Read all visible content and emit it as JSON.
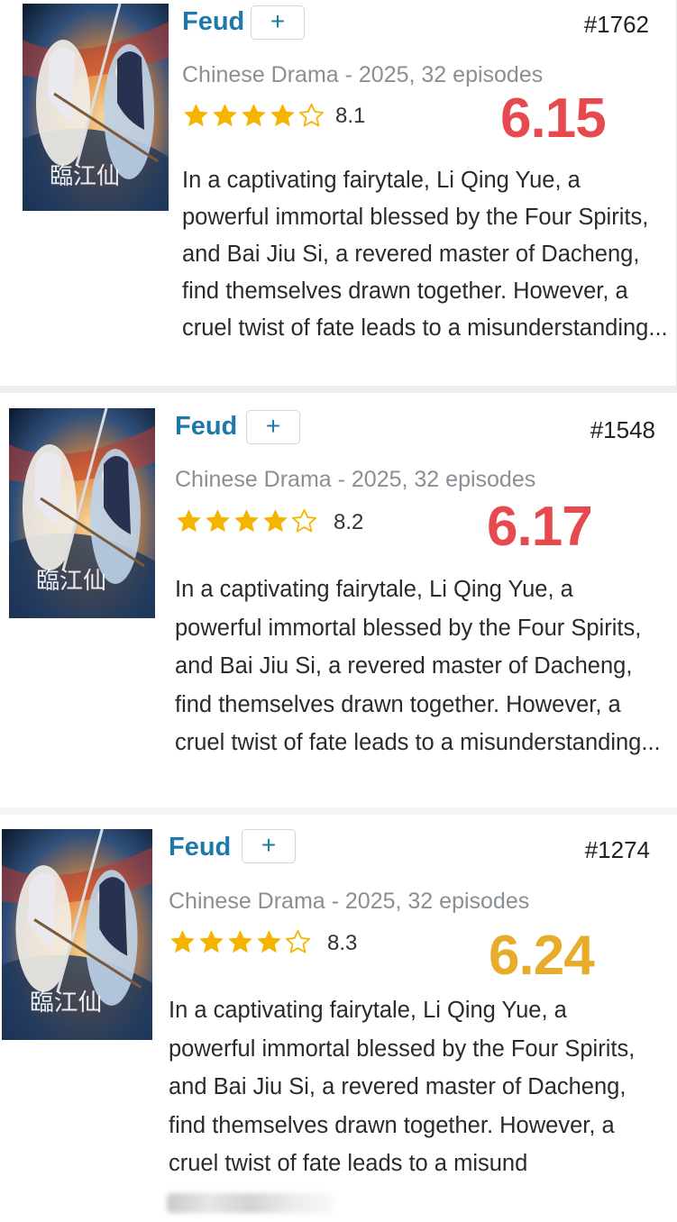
{
  "colors": {
    "title": "#1c79aa",
    "star": "#f5b400",
    "score_red": "#e64a4f",
    "score_gold": "#e8ac2c"
  },
  "entries": [
    {
      "title": "Feud",
      "add_label": "+",
      "rank": "#1762",
      "meta": "Chinese Drama - 2025, 32 episodes",
      "stars": 4,
      "rating": "8.1",
      "score": "6.15",
      "score_color": "red",
      "description": "In a captivating fairytale, Li Qing Yue, a powerful immortal blessed by the Four Spirits, and Bai Jiu Si, a revered master of Dacheng, find themselves drawn together. However, a cruel twist of fate leads to a misunderstanding...",
      "poster_icon": "poster-image"
    },
    {
      "title": "Feud",
      "add_label": "+",
      "rank": "#1548",
      "meta": "Chinese Drama - 2025, 32 episodes",
      "stars": 4,
      "rating": "8.2",
      "score": "6.17",
      "score_color": "red",
      "description": "In a captivating fairytale, Li Qing Yue, a powerful immortal blessed by the Four Spirits, and Bai Jiu Si, a revered master of Dacheng, find themselves drawn together. However, a cruel twist of fate leads to a misunderstanding...",
      "poster_icon": "poster-image"
    },
    {
      "title": "Feud",
      "add_label": "+",
      "rank": "#1274",
      "meta": "Chinese Drama - 2025, 32 episodes",
      "stars": 4,
      "rating": "8.3",
      "score": "6.24",
      "score_color": "gold",
      "description": "In a captivating fairytale, Li Qing Yue, a powerful immortal blessed by the Four Spirits, and Bai Jiu Si, a revered master of Dacheng, find themselves drawn together. However, a cruel twist of fate leads to a",
      "description_tail": "misund",
      "poster_icon": "poster-image"
    }
  ]
}
